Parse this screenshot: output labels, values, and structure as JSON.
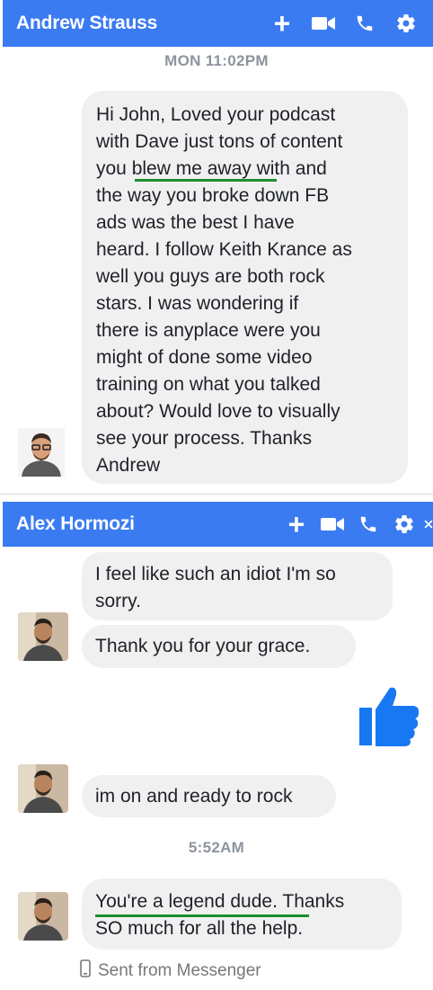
{
  "panel1": {
    "header_name": "Andrew Strauss",
    "timestamp": "MON 11:02PM",
    "message_lines": [
      "Hi John, Loved your podcast",
      "with Dave just tons of content",
      "you blew me away with and",
      "the way you broke down FB",
      "ads was the best I have",
      "heard. I follow Keith Krance as",
      "well you guys are both rock",
      "stars.  I was wondering  if",
      "there is anyplace were you",
      "might of done some video",
      "training on what you talked",
      "about? Would love to visually",
      "see your process. Thanks",
      "Andrew"
    ]
  },
  "panel2": {
    "header_name": "Alex Hormozi",
    "messages": {
      "m1_line1": "I feel like such an idiot I'm so",
      "m1_line2": "sorry.",
      "m2": "Thank you for your grace.",
      "m3": "im on and ready to rock",
      "m4_line1": "You're a legend dude. Thanks",
      "m4_line2": "SO much for all the help."
    },
    "timestamp": "5:52AM",
    "sent_from": "Sent from Messenger"
  },
  "colors": {
    "header": "#3b7bf2",
    "bubble": "#f1f0f0",
    "underline": "#1a8f2f",
    "thumb": "#1877f2"
  },
  "icons": [
    "plus-icon",
    "video-icon",
    "phone-icon",
    "gear-icon",
    "close-icon",
    "like-icon",
    "phone-small-icon"
  ]
}
